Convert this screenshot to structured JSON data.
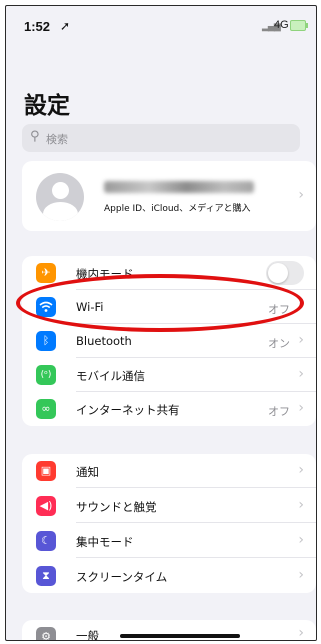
{
  "status_bar": {
    "time": "1:52",
    "location_glyph": "➚",
    "signal": "▂▄▆",
    "network": "4G",
    "battery_color": "#8fd37d"
  },
  "page_title": "設定",
  "search": {
    "placeholder": "検索"
  },
  "profile": {
    "subtitle": "Apple ID、iCloud、メディアと購入"
  },
  "groups": [
    {
      "rows": [
        {
          "label": "機内モード",
          "icon": "airplane-icon",
          "icon_color": "#ff9500",
          "value": "",
          "control": "toggle",
          "toggle_on": false
        },
        {
          "label": "Wi-Fi",
          "icon": "wifi-icon",
          "icon_color": "#007aff",
          "value": "オフ"
        },
        {
          "label": "Bluetooth",
          "icon": "bluetooth-icon",
          "icon_color": "#007aff",
          "value": "オン"
        },
        {
          "label": "モバイル通信",
          "icon": "cellular-icon",
          "icon_color": "#34c759",
          "value": ""
        },
        {
          "label": "インターネット共有",
          "icon": "hotspot-icon",
          "icon_color": "#34c759",
          "value": "オフ"
        }
      ]
    },
    {
      "rows": [
        {
          "label": "通知",
          "icon": "notifications-icon",
          "icon_color": "#ff3b30",
          "value": ""
        },
        {
          "label": "サウンドと触覚",
          "icon": "sound-icon",
          "icon_color": "#ff2d55",
          "value": ""
        },
        {
          "label": "集中モード",
          "icon": "focus-moon-icon",
          "icon_color": "#5856d6",
          "value": ""
        },
        {
          "label": "スクリーンタイム",
          "icon": "hourglass-icon",
          "icon_color": "#5856d6",
          "value": ""
        }
      ]
    },
    {
      "rows": [
        {
          "label": "一般",
          "icon": "gear-icon",
          "icon_color": "#8e8e93",
          "value": ""
        }
      ]
    }
  ],
  "annotation": {
    "shape": "ellipse",
    "color": "#e01010",
    "target": "Wi-Fi"
  }
}
